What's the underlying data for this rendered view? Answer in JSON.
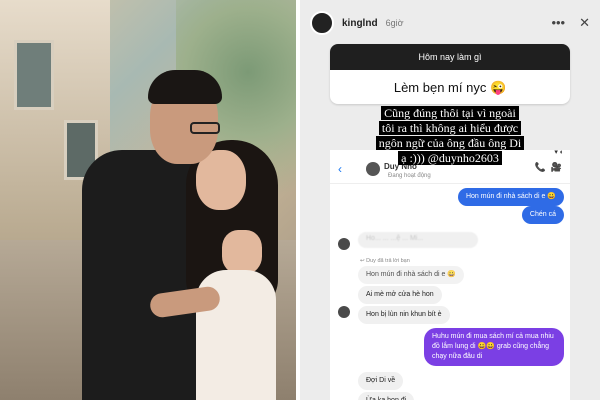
{
  "story": {
    "username": "kinglnd",
    "time": "6giờ",
    "actions": {
      "more": "•••",
      "close": "✕"
    },
    "progress_fraction": 0.45,
    "question": {
      "prompt": "Hôm nay làm gì",
      "answer": "Lèm bẹn mí nyc 😜"
    },
    "overlay_lines": [
      "Cũng đúng thôi tại vì ngoài",
      "tôi ra thì không ai hiểu được",
      "ngôn ngữ của ông đầu ông Di",
      "ạ :))) @duynho2603"
    ]
  },
  "chat": {
    "back_icon": "‹",
    "contact_name": "Duy Nhỏ",
    "contact_status": "Đang hoạt động",
    "call_icon": "📞",
    "video_icon": "🎥",
    "status_icons": "▾ ◐",
    "messages": [
      {
        "side": "out",
        "text": "Hon mún đi nhà sách di e 😀"
      },
      {
        "side": "out",
        "text": "Chén cá"
      },
      {
        "side": "in",
        "text": "Hon mún đi nhà sách di e 😀",
        "note": "↩ Duy đã trả lời bạn"
      },
      {
        "side": "in",
        "text": "Ai mè mở cửa hè hon"
      },
      {
        "side": "in",
        "text": "Hon bị lùn nin khun bít è"
      },
      {
        "side": "out2",
        "text": "Huhu mún đi mua sách mí cả mua nhiu đồ lắm lung di 😀😀 grab cũng chẳng chạy nữa đâu di"
      },
      {
        "side": "in",
        "text": "Đợi Di về"
      },
      {
        "side": "in",
        "text": "Ừa ka hon đi"
      }
    ],
    "blurred_text": "Ho... ... ...ệ ... Mi..."
  }
}
